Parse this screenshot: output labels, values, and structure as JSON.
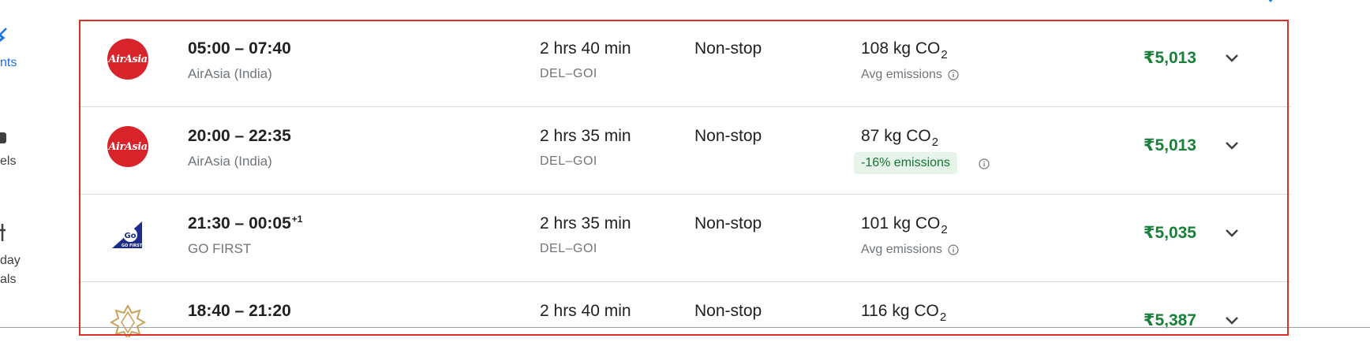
{
  "side_nav": {
    "items": [
      {
        "label": "nts",
        "icon": "plane-icon",
        "active": true
      },
      {
        "label": "els",
        "icon": "bed-icon",
        "active": false
      },
      {
        "label_line1": "day",
        "label_line2": "als",
        "icon": "tag-icon",
        "active": false
      }
    ]
  },
  "colors": {
    "accent_blue": "#1a73e8",
    "price_green": "#188038",
    "badge_bg": "#e6f4ea",
    "badge_text": "#137333",
    "highlight_red": "#d93025",
    "airasia_red": "#d8232a",
    "gofirst_blue": "#1c2c8c",
    "vistara_gold": "#c9a35a"
  },
  "flights": [
    {
      "logo": "airasia-logo",
      "logo_text": "AirAsia",
      "departure": "05:00",
      "separator": " – ",
      "arrival": "07:40",
      "day_offset": "",
      "airline": "AirAsia (India)",
      "duration": "2 hrs 40 min",
      "route": "DEL–GOI",
      "stops": "Non-stop",
      "co2_value": "108 kg CO",
      "co2_sub": "2",
      "emissions_label": "Avg emissions",
      "emissions_type": "avg",
      "price": "₹5,013"
    },
    {
      "logo": "airasia-logo",
      "logo_text": "AirAsia",
      "departure": "20:00",
      "separator": " – ",
      "arrival": "22:35",
      "day_offset": "",
      "airline": "AirAsia (India)",
      "duration": "2 hrs 35 min",
      "route": "DEL–GOI",
      "stops": "Non-stop",
      "co2_value": "87 kg CO",
      "co2_sub": "2",
      "emissions_label": "-16% emissions",
      "emissions_type": "badge",
      "price": "₹5,013"
    },
    {
      "logo": "gofirst-logo",
      "logo_text": "GO FIRST",
      "departure": "21:30",
      "separator": " – ",
      "arrival": "00:05",
      "day_offset": "+1",
      "airline": "GO FIRST",
      "duration": "2 hrs 35 min",
      "route": "DEL–GOI",
      "stops": "Non-stop",
      "co2_value": "101 kg CO",
      "co2_sub": "2",
      "emissions_label": "Avg emissions",
      "emissions_type": "avg",
      "price": "₹5,035"
    },
    {
      "logo": "vistara-logo",
      "logo_text": "",
      "departure": "18:40",
      "separator": " – ",
      "arrival": "21:20",
      "day_offset": "",
      "airline": "",
      "duration": "2 hrs 40 min",
      "route": "",
      "stops": "Non-stop",
      "co2_value": "116 kg CO",
      "co2_sub": "2",
      "emissions_label": "",
      "emissions_type": "none",
      "price": "₹5,387"
    }
  ]
}
